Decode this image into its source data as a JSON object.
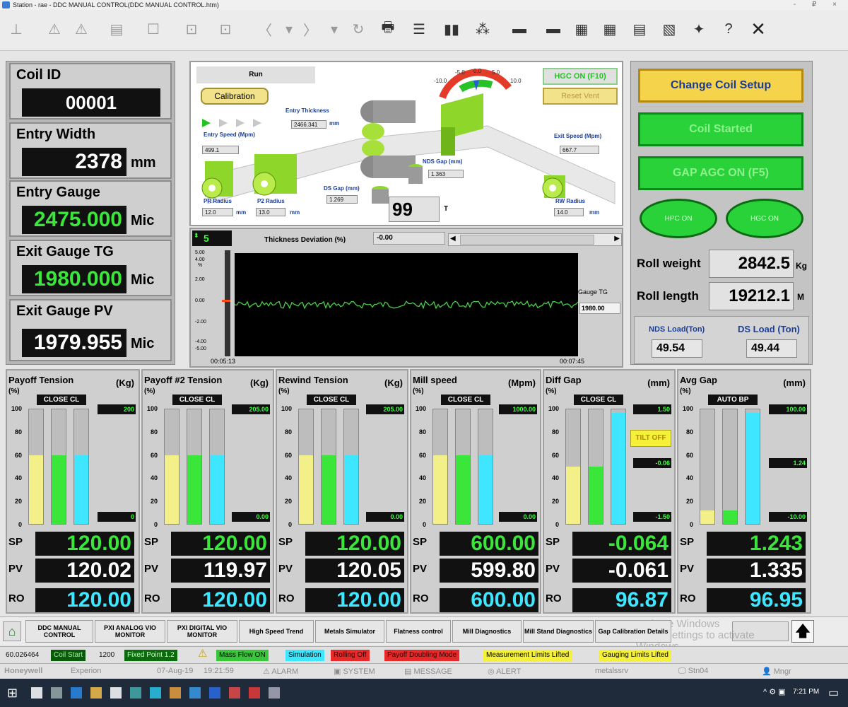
{
  "window": {
    "title": "Station - rae - DDC MANUAL CONTROL(DDC MANUAL CONTROL.htm)",
    "controls": "- ₽ ×"
  },
  "toolbar": {
    "icons": [
      "hierarchy-icon",
      "warning-icon",
      "warning-outline-icon",
      "panel-icon",
      "blank-icon",
      "dropdown-box-icon",
      "up-box-icon",
      "back-icon",
      "down-icon",
      "forward-icon",
      "down-icon",
      "refresh-icon",
      "printer-icon",
      "checklist-icon",
      "bars-icon",
      "network-icon",
      "display-icon",
      "monitor-icon",
      "chart-window-icon",
      "trend-window-icon",
      "stack-window-icon",
      "add-window-icon",
      "puzzle-icon",
      "help-icon",
      "close-icon"
    ],
    "glyphs": [
      "⊥",
      "⚠",
      "⚠",
      "▤",
      "☐",
      "⊡",
      "⊡",
      "〈",
      "▾",
      "〉",
      "▾",
      "↻",
      "🖶",
      "☰",
      "▮▮",
      "⁂",
      "▬",
      "▬",
      "▦",
      "▦",
      "▤",
      "▧",
      "✦",
      "?",
      "✕"
    ]
  },
  "left": {
    "coil_id_label": "Coil ID",
    "coil_id": "00001",
    "entry_width_label": "Entry Width",
    "entry_width": "2378",
    "entry_width_unit": "mm",
    "entry_gauge_label": "Entry Gauge",
    "entry_gauge": "2475.000",
    "entry_gauge_unit": "Mic",
    "exit_gauge_tg_label": "Exit Gauge TG",
    "exit_gauge_tg": "1980.000",
    "exit_gauge_tg_unit": "Mic",
    "exit_gauge_pv_label": "Exit Gauge PV",
    "exit_gauge_pv": "1979.955",
    "exit_gauge_pv_unit": "Mic"
  },
  "diagram": {
    "run": "Run",
    "calibration": "Calibration",
    "hgc_on": "HGC ON (F10)",
    "reset_vent": "Reset Vent",
    "entry_thickness_label": "Entry Thickness",
    "entry_thickness": "2466.341",
    "entry_thickness_unit": "mm",
    "entry_speed_label": "Entry Speed (Mpm)",
    "entry_speed": "499.1",
    "exit_speed_label": "Exit Speed (Mpm)",
    "exit_speed": "667.7",
    "nds_gap_label": "NDS Gap (mm)",
    "nds_gap": "1.363",
    "ds_gap_label": "DS Gap (mm)",
    "ds_gap": "1.269",
    "force": "99",
    "force_unit": "T",
    "pr_radius_label": "PR Radius",
    "pr_radius": "12.0",
    "pr_radius_unit": "mm",
    "p2_radius_label": "P2 Radius",
    "p2_radius": "13.0",
    "p2_radius_unit": "mm",
    "rw_radius_label": "RW Radius",
    "rw_radius": "14.0",
    "rw_radius_unit": "mm",
    "dial_ticks": [
      "-10.0",
      "-5.0",
      "0.0",
      "5.0",
      "10.0"
    ]
  },
  "trend": {
    "spinner": "5",
    "title": "Thickness Deviation (%)",
    "value": "-0.00",
    "y_ticks": [
      "5.00",
      "4.00",
      "2.00",
      "0.00",
      "-2.00",
      "-4.00",
      "-5.00"
    ],
    "y_unit": "%",
    "x_start": "00:05:13",
    "x_end": "00:07:45",
    "gauge_tg_label": "Gauge TG",
    "gauge_tg": "1980.00"
  },
  "right": {
    "change_coil": "Change Coil Setup",
    "coil_started": "Coil Started",
    "gap_agc": "GAP AGC ON (F5)",
    "hpc_on": "HPC ON",
    "hgc_on": "HGC ON",
    "roll_weight_label": "Roll weight",
    "roll_weight": "2842.5",
    "roll_weight_unit": "Kg",
    "roll_length_label": "Roll length",
    "roll_length": "19212.1",
    "roll_length_unit": "M",
    "nds_load_label": "NDS Load(Ton)",
    "nds_load": "49.54",
    "ds_load_label": "DS Load (Ton)",
    "ds_load": "49.44"
  },
  "gauges": [
    {
      "title": "Payoff Tension",
      "unit": "(Kg)",
      "pct": "(%)",
      "mode": "CLOSE CL",
      "ticks": [
        "100",
        "80",
        "60",
        "40",
        "20",
        "0"
      ],
      "bars": [
        0.6,
        0.6,
        0.6
      ],
      "top": "200",
      "mid": "",
      "bottom": "0",
      "sp": "120.00",
      "pv": "120.02",
      "ro": "120.00"
    },
    {
      "title": "Payoff #2 Tension",
      "unit": "(Kg)",
      "pct": "(%)",
      "mode": "CLOSE CL",
      "ticks": [
        "100",
        "80",
        "60",
        "40",
        "20",
        "0"
      ],
      "bars": [
        0.6,
        0.6,
        0.6
      ],
      "top": "205.00",
      "mid": "",
      "bottom": "0.00",
      "sp": "120.00",
      "pv": "119.97",
      "ro": "120.00"
    },
    {
      "title": "Rewind Tension",
      "unit": "(Kg)",
      "pct": "(%)",
      "mode": "CLOSE CL",
      "ticks": [
        "100",
        "80",
        "60",
        "40",
        "20",
        "0"
      ],
      "bars": [
        0.6,
        0.6,
        0.6
      ],
      "top": "205.00",
      "mid": "",
      "bottom": "0.00",
      "sp": "120.00",
      "pv": "120.05",
      "ro": "120.00"
    },
    {
      "title": "Mill speed",
      "unit": "(Mpm)",
      "pct": "(%)",
      "mode": "CLOSE CL",
      "ticks": [
        "100",
        "80",
        "60",
        "40",
        "20",
        "0"
      ],
      "bars": [
        0.6,
        0.6,
        0.6
      ],
      "top": "1000.00",
      "mid": "",
      "bottom": "0.00",
      "sp": "600.00",
      "pv": "599.80",
      "ro": "600.00"
    },
    {
      "title": "Diff Gap",
      "unit": "(mm)",
      "pct": "(%)",
      "mode": "CLOSE CL",
      "ticks": [
        "100",
        "80",
        "60",
        "40",
        "20",
        "0"
      ],
      "bars": [
        0.5,
        0.5,
        0.97
      ],
      "top": "1.50",
      "mid": "-0.06",
      "bottom": "-1.50",
      "tilt": "TILT OFF",
      "sp": "-0.064",
      "pv": "-0.061",
      "ro": "96.87"
    },
    {
      "title": "Avg Gap",
      "unit": "(mm)",
      "pct": "(%)",
      "mode": "AUTO BP",
      "ticks": [
        "100",
        "80",
        "60",
        "40",
        "20",
        "0"
      ],
      "bars": [
        0.12,
        0.12,
        0.97
      ],
      "top": "100.00",
      "mid": "1.24",
      "bottom": "-10.00",
      "sp": "1.243",
      "pv": "1.335",
      "ro": "96.95"
    }
  ],
  "labels": {
    "sp": "SP",
    "pv": "PV",
    "ro": "RO"
  },
  "nav": [
    "DDC MANUAL CONTROL",
    "PXI ANALOG VIO MONITOR",
    "PXI DIGITAL VIO MONITOR",
    "High Speed Trend",
    "Metals Simulator",
    "Flatness control",
    "Mill Diagnostics",
    "Mill Stand Diagnostics",
    "Gap Calibration Details"
  ],
  "watermark": "Activate Windows\nGo to Settings to activate Windows.",
  "status": [
    "60.026464",
    "Coil Start",
    "1200",
    "Fixed Point 1.2",
    "Mass Flow ON",
    "Simulation",
    "Rolling Off",
    "Payoff Doubling Mode",
    "Measurement Limits Lifted",
    "Gauging Limits Lifted"
  ],
  "alarmbar": {
    "brand": "Honeywell",
    "app": "Experion",
    "date": "07-Aug-19",
    "time": "19:21:59",
    "alarm": "ALARM",
    "system": "SYSTEM",
    "message": "MESSAGE",
    "alert": "ALERT",
    "server": "metalssrv",
    "station": "Stn04",
    "user": "Mngr"
  },
  "taskbar": {
    "time": "7:21 PM"
  },
  "colors": {
    "green": "#39e639",
    "cyan": "#3ee6ff",
    "yellow": "#f3f08a",
    "panel": "#cfcfcf"
  }
}
